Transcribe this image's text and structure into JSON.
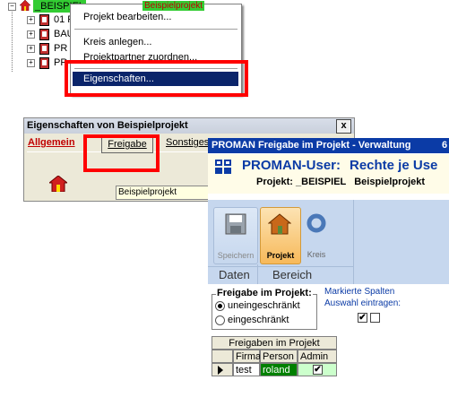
{
  "tree": {
    "root_label": "_BEISPIEL",
    "root_sub": "Beispielprojekt",
    "items": [
      {
        "label": "01 F"
      },
      {
        "label": "BAU"
      },
      {
        "label": "PR"
      },
      {
        "label": "PR"
      }
    ]
  },
  "context_menu": {
    "items": [
      "Projekt bearbeiten...",
      "Kreis anlegen...",
      "Projektpartner zuordnen...",
      "Eigenschaften..."
    ],
    "highlighted": "Eigenschaften..."
  },
  "dialog1": {
    "title": "Eigenschaften von Beispielprojekt",
    "close": "x",
    "tabs": [
      "Allgemein",
      "Freigabe",
      "Sonstiges"
    ],
    "field_value": "Beispielprojekt"
  },
  "dialog2": {
    "title": "PROMAN Freigabe im Projekt - Verwaltung",
    "title_suffix": "6",
    "header_left": "PROMAN-User:",
    "header_right": "Rechte je Use",
    "project_line": "Projekt: _BEISPIEL   Beispielprojekt",
    "ribbon": {
      "buttons": [
        {
          "label": "Speichern",
          "icon": "floppy-disk-icon"
        },
        {
          "label": "Projekt",
          "icon": "house-icon"
        },
        {
          "label": "Kreis",
          "icon": "circle-icon"
        }
      ],
      "groups": [
        "Daten",
        "Bereich"
      ]
    },
    "freigabe": {
      "label": "Freigabe im Projekt:",
      "options": [
        "uneingeschränkt",
        "eingeschränkt"
      ],
      "selected": "uneingeschränkt"
    },
    "markierte": {
      "line1": "Markierte Spalten",
      "line2": "Auswahl eintragen:"
    },
    "grid": {
      "caption": "Freigaben im Projekt",
      "columns": [
        "Firma",
        "Person",
        "Admin"
      ],
      "rows": [
        {
          "firma": "test",
          "person": "roland",
          "admin": "✔"
        }
      ]
    }
  },
  "colors": {
    "tree_root_highlight": "#33cc33",
    "red_box": "#ff0000",
    "ribbon_bg": "#c6d7ee",
    "active_button": "#f7b95a",
    "title_blue": "#0b3ba6",
    "menu_highlight": "#0a246a"
  }
}
